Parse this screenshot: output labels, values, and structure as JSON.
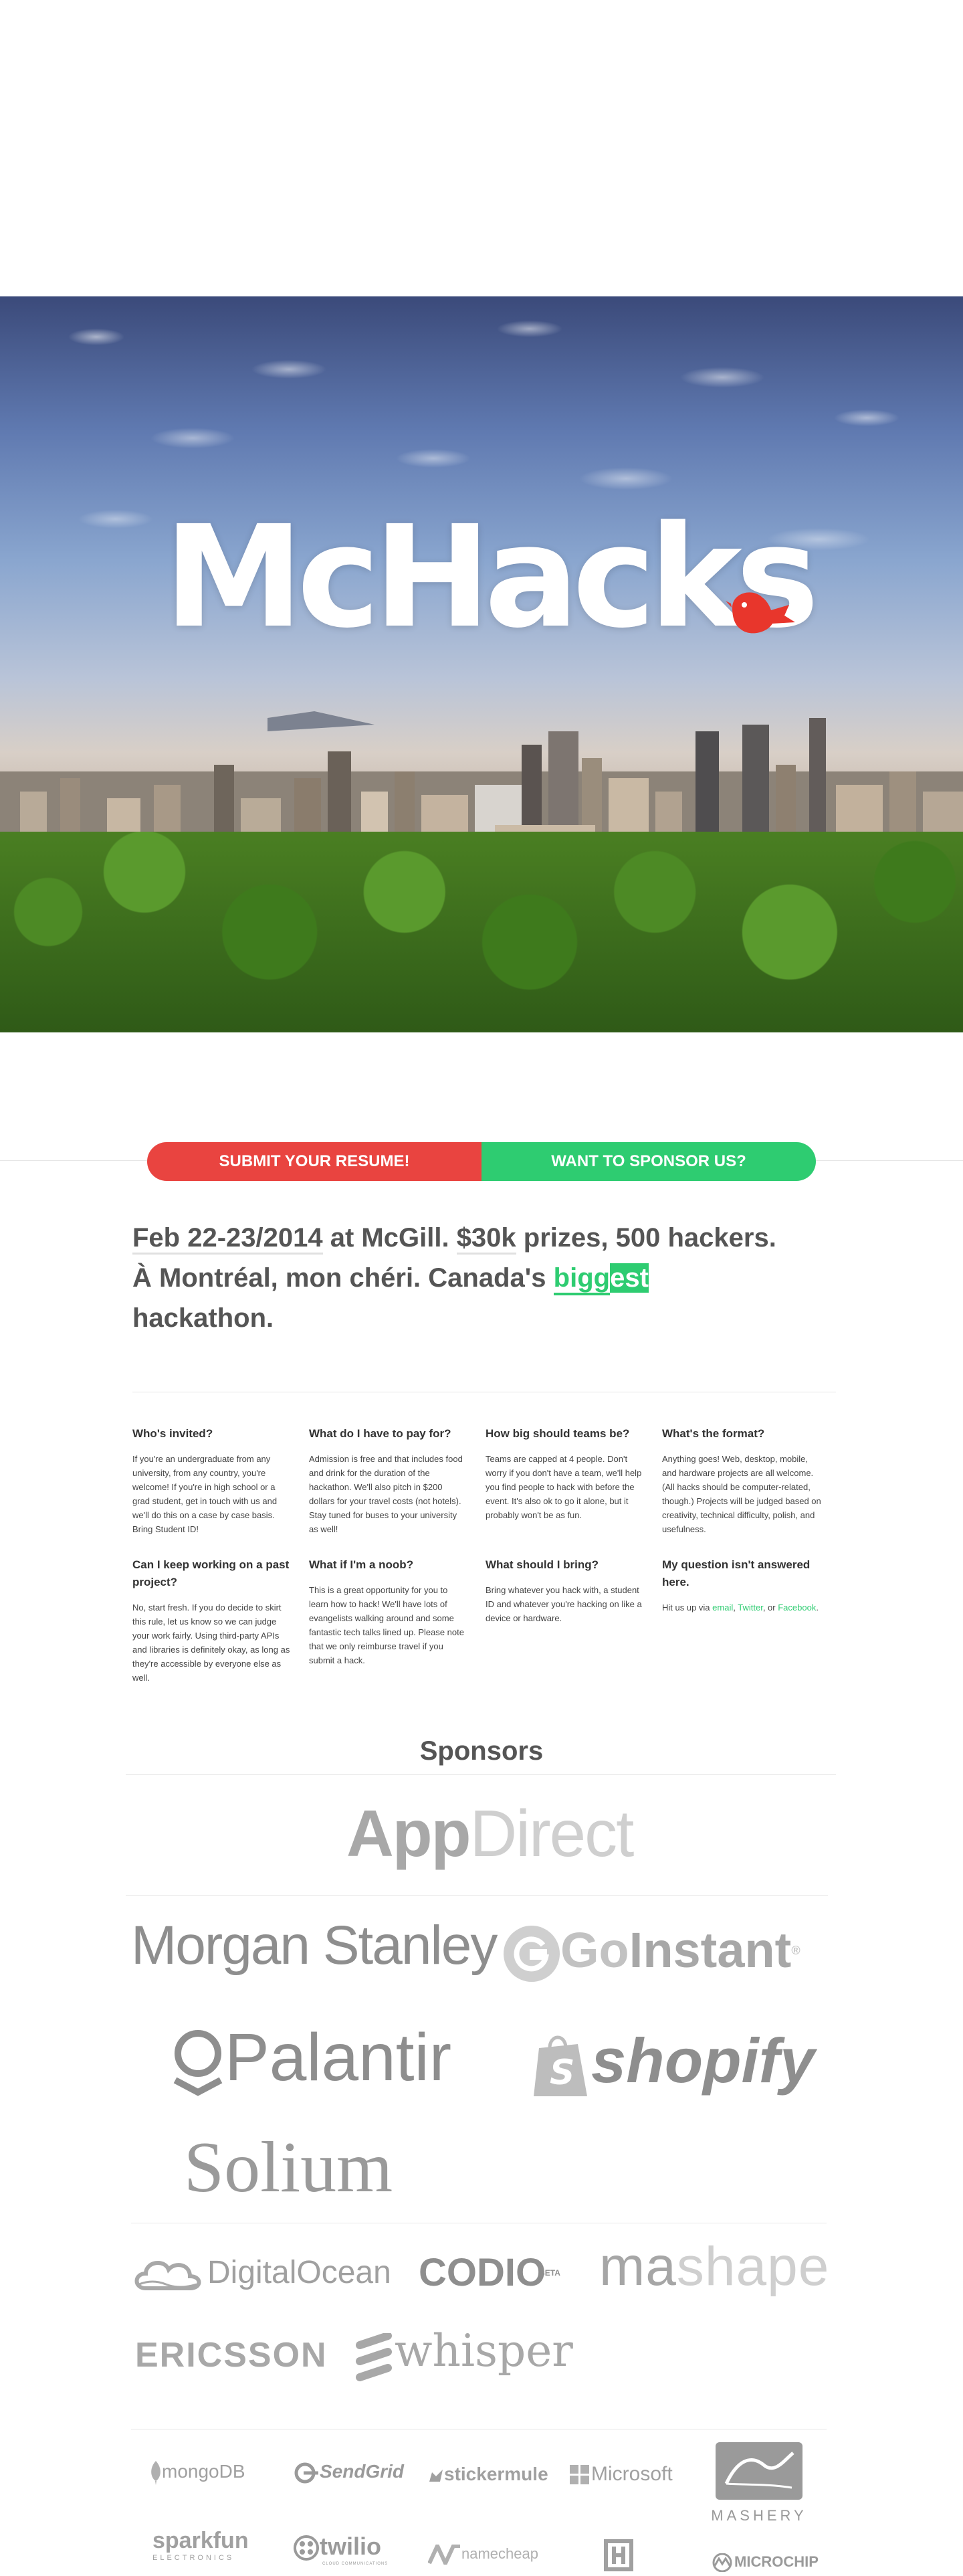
{
  "hero": {
    "title": "McHacks"
  },
  "cta": {
    "resume": "SUBMIT YOUR RESUME!",
    "sponsor": "WANT TO SPONSOR US?"
  },
  "headline": {
    "date": "Feb 22-23/2014",
    "at": " at McGill. ",
    "prizes": "$30k",
    "prizes_rest": " prizes, 500 hackers.",
    "line2_start": "À Montréal, mon chéri. Canada's ",
    "big_a": "bigg",
    "big_b": "est",
    "line3": "hackathon."
  },
  "faq": [
    {
      "q": "Who's invited?",
      "a": "If you're an undergraduate from any university, from any country, you're welcome! If you're in high school or a grad student, get in touch with us and we'll do this on a case by case basis. Bring Student ID!"
    },
    {
      "q": "What do I have to pay for?",
      "a": "Admission is free and that includes food and drink for the duration of the hackathon. We'll also pitch in $200 dollars for your travel costs (not hotels). Stay tuned for buses to your university as well!"
    },
    {
      "q": "How big should teams be?",
      "a": "Teams are capped at 4 people. Don't worry if you don't have a team, we'll help you find people to hack with before the event. It's also ok to go it alone, but it probably won't be as fun."
    },
    {
      "q": "What's the format?",
      "a": "Anything goes! Web, desktop, mobile, and hardware projects are all welcome. (All hacks should be computer-related, though.) Projects will be judged based on creativity, technical difficulty, polish, and usefulness."
    },
    {
      "q": "Can I keep working on a past project?",
      "a": "No, start fresh. If you do decide to skirt this rule, let us know so we can judge your work fairly. Using third-party APIs and libraries is definitely okay, as long as they're accessible by everyone else as well."
    },
    {
      "q": "What if I'm a noob?",
      "a": "This is a great opportunity for you to learn how to hack! We'll have lots of evangelists walking around and some fantastic tech talks lined up. Please note that we only reimburse travel if you submit a hack."
    },
    {
      "q": "What should I bring?",
      "a": "Bring whatever you hack with, a student ID and whatever you're hacking on like a device or hardware."
    },
    {
      "q": "My question isn't answered here.",
      "a_prefix": "Hit us up via ",
      "email": "email",
      "comma": ", ",
      "twitter": "Twitter",
      "or": ", or ",
      "facebook": "Facebook",
      "period": "."
    }
  ],
  "sponsors": {
    "title": "Sponsors",
    "tier1": {
      "appdirect_a": "App",
      "appdirect_b": "Direct"
    },
    "tier2": {
      "morgan": "Morgan Stanley",
      "goinstant_a": "Go",
      "goinstant_b": "Instant",
      "palantir": "Palantir",
      "shopify": "shopify",
      "solium": "Solium"
    },
    "tier3": {
      "digitalocean": "DigitalOcean",
      "codio": "CODIO",
      "codio_beta": "BETA",
      "mashape_a": "ma",
      "mashape_b": "shape",
      "ericsson": "ERICSSON",
      "whisper": "whisper"
    },
    "tier4": {
      "mongodb": "mongoDB",
      "sendgrid": "SendGrid",
      "stickermule": "stickermule",
      "microsoft": "Microsoft",
      "mashery": "MASHERY",
      "sparkfun": "sparkfun",
      "sparkfun_sub": "ELECTRONICS",
      "twilio": "twilio",
      "twilio_sub": "CLOUD COMMUNICATIONS",
      "namecheap": "namecheap",
      "microchip": "MICROCHIP"
    }
  }
}
